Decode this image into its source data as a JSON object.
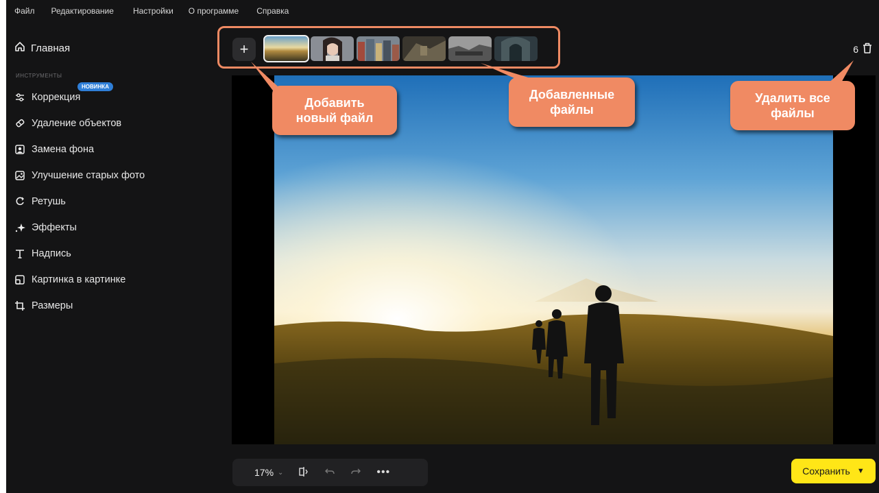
{
  "menu": [
    "Файл",
    "Редактирование",
    "Настройки",
    "О программе",
    "Справка"
  ],
  "sidebar": {
    "home_label": "Главная",
    "section_label": "ИНСТРУМЕНТЫ",
    "new_badge": "НОВИНКА",
    "tools": [
      {
        "label": "Коррекция",
        "icon": "sliders-icon"
      },
      {
        "label": "Удаление объектов",
        "icon": "eraser-icon"
      },
      {
        "label": "Замена фона",
        "icon": "portrait-icon"
      },
      {
        "label": "Улучшение старых фото",
        "icon": "photo-enhance-icon"
      },
      {
        "label": "Ретушь",
        "icon": "retouch-icon"
      },
      {
        "label": "Эффекты",
        "icon": "sparkle-icon"
      },
      {
        "label": "Надпись",
        "icon": "text-icon"
      },
      {
        "label": "Картинка в картинке",
        "icon": "picture-in-picture-icon"
      },
      {
        "label": "Размеры",
        "icon": "crop-icon"
      }
    ]
  },
  "files": {
    "count": "6",
    "thumbnails": 6
  },
  "toolbar": {
    "zoom": "17%",
    "save_label": "Сохранить"
  },
  "callouts": {
    "add": "Добавить новый файл",
    "added": "Добавленные файлы",
    "delete_all": "Удалить все файлы"
  },
  "colors": {
    "accent_yellow": "#ffe617",
    "callout_orange": "#f08a63",
    "badge_blue": "#2f7fd8",
    "background": "#141415"
  }
}
